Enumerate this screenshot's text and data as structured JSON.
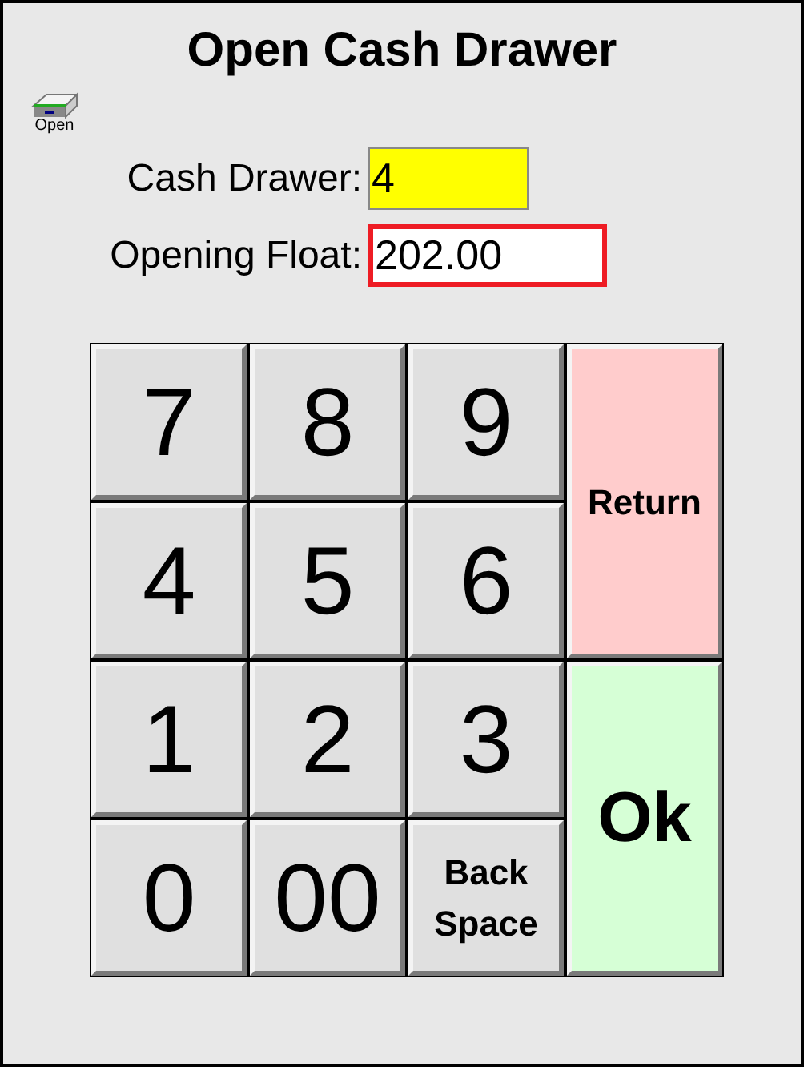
{
  "window": {
    "title": "Open Cash Drawer"
  },
  "toolbar": [
    {
      "label": "Open"
    }
  ],
  "fields": [
    {
      "label": "Cash Drawer:",
      "value": "4",
      "color": "#ffff00",
      "focused": false
    },
    {
      "label": "Opening Float:",
      "value": "202.00",
      "color": "#ffffff",
      "focused": true
    }
  ],
  "keypad": [
    {
      "kind": "digit",
      "label": "7"
    },
    {
      "kind": "digit",
      "label": "8"
    },
    {
      "kind": "digit",
      "label": "9"
    },
    {
      "kind": "return",
      "label": "Return"
    },
    {
      "kind": "digit",
      "label": "4"
    },
    {
      "kind": "digit",
      "label": "5"
    },
    {
      "kind": "digit",
      "label": "6"
    },
    {
      "kind": "digit",
      "label": "1"
    },
    {
      "kind": "digit",
      "label": "2"
    },
    {
      "kind": "digit",
      "label": "3"
    },
    {
      "kind": "ok",
      "label": "Ok"
    },
    {
      "kind": "digit",
      "label": "0"
    },
    {
      "kind": "digit",
      "label": "00"
    },
    {
      "kind": "backspace",
      "label": "Back Space"
    }
  ]
}
